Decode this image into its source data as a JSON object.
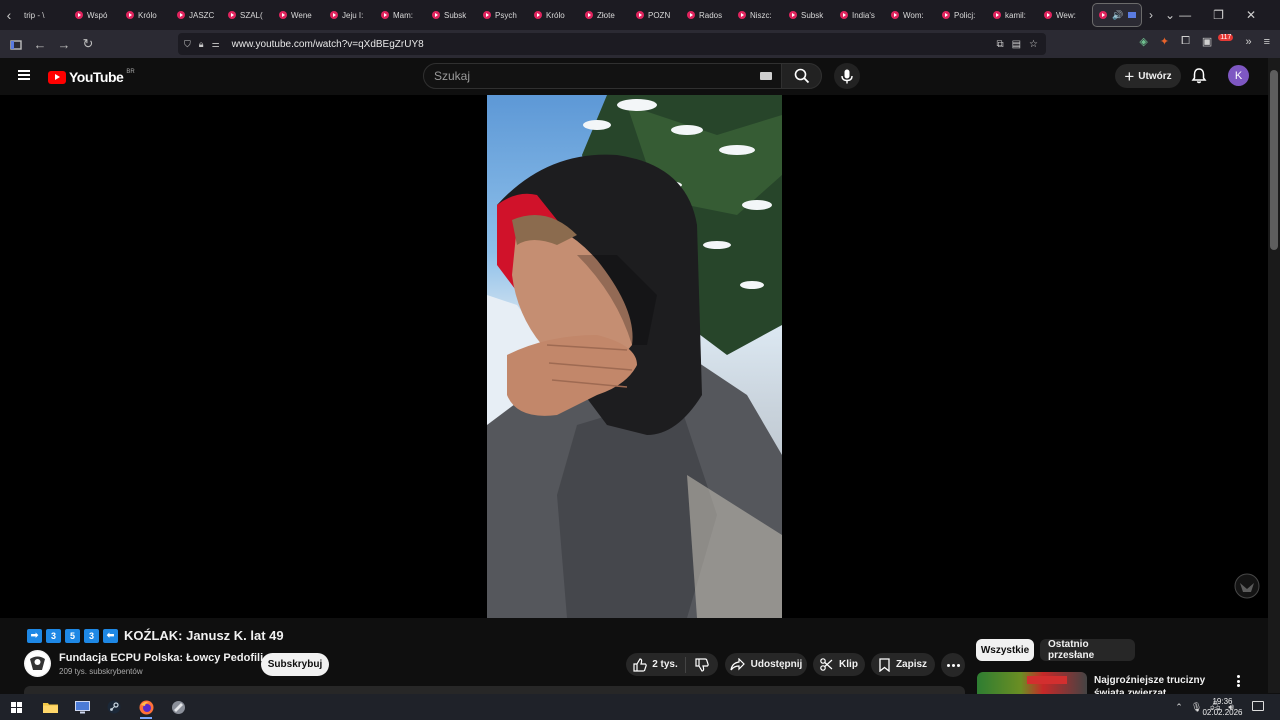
{
  "browser": {
    "tabs": [
      "trip - \\",
      "Wspó",
      "Królo",
      "JASZC",
      "SZAL(",
      "Wene",
      "Jeju I:",
      "Mam:",
      "Subsk",
      "Psych",
      "Królo",
      "Złote",
      "POZN",
      "Rados",
      "Niszc:",
      "Subsk",
      "India's",
      "Wom:",
      "Policj:",
      "kamil:",
      "Wew:"
    ],
    "url": "www.youtube.com/watch?v=qXdBEgZrUY8",
    "extension_badge": "117"
  },
  "youtube": {
    "logo_text": "YouTube",
    "country_code": "BR",
    "search_placeholder": "Szukaj",
    "create_label": "Utwórz",
    "avatar_letter": "K"
  },
  "video": {
    "title_badges": [
      "➡",
      "3",
      "5",
      "3",
      "⬅"
    ],
    "title": "KOŹLAK: Janusz K. lat 49",
    "channel_name": "Fundacja ECPU Polska: Łowcy Pedofili",
    "subscribers": "209 tys. subskrybentów",
    "subscribe_label": "Subskrybuj",
    "likes": "2 tys.",
    "share_label": "Udostępnij",
    "clip_label": "Klip",
    "save_label": "Zapisz"
  },
  "sidebar": {
    "chips": [
      "Wszystkie",
      "Ostatnio przesłane"
    ],
    "rec_title": "Najgroźniejsze trucizny świata zwierząt"
  },
  "taskbar": {
    "time": "19:36",
    "date": "02.02.2026"
  },
  "colors": {
    "brand": "#ff0000",
    "background": "#0f0f0f",
    "accent_badge": "#1e88e5"
  }
}
